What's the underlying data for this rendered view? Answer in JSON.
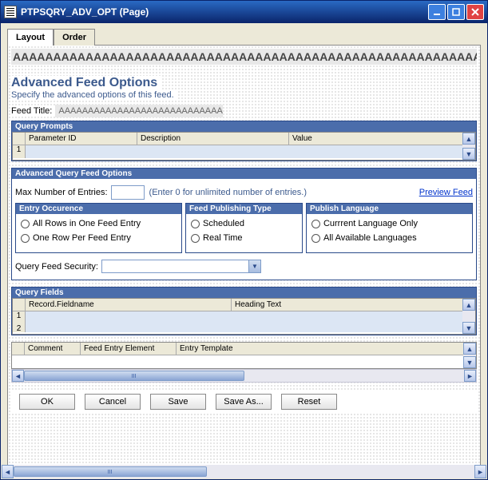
{
  "window": {
    "title": "PTPSQRY_ADV_OPT (Page)"
  },
  "tabs": {
    "layout": "Layout",
    "order": "Order"
  },
  "banner": "AAAAAAAAAAAAAAAAAAAAAAAAAAAAAAAAAAAAAAAAAAAAAAAAAAAAAAAAAAAAAAA",
  "heading": "Advanced Feed Options",
  "subheading": "Specify the advanced options of this feed.",
  "feed_title": {
    "label": "Feed Title:",
    "value": "AAAAAAAAAAAAAAAAAAAAAAAAAAAAAA"
  },
  "query_prompts": {
    "title": "Query Prompts",
    "columns": {
      "param_id": "Parameter ID",
      "description": "Description",
      "value": "Value"
    },
    "rownum1": "1"
  },
  "adv_options": {
    "title": "Advanced Query Feed Options",
    "max_entries_label": "Max Number of Entries:",
    "max_entries_value": "",
    "max_entries_hint": "(Enter 0 for unlimited number of entries.)",
    "preview_link": "Preview Feed",
    "entry_occurrence": {
      "title": "Entry Occurence",
      "opt_allrows": "All Rows in One Feed Entry",
      "opt_onerow": "One Row Per Feed Entry"
    },
    "publishing_type": {
      "title": "Feed Publishing Type",
      "opt_scheduled": "Scheduled",
      "opt_realtime": "Real Time"
    },
    "publish_language": {
      "title": "Publish Language",
      "opt_current": "Currrent Language Only",
      "opt_all": "All Available Languages"
    },
    "feed_security_label": "Query Feed Security:",
    "feed_security_value": ""
  },
  "query_fields": {
    "title": "Query Fields",
    "columns": {
      "recfield": "Record.Fieldname",
      "heading": "Heading Text"
    },
    "rownum1": "1",
    "rownum2": "2"
  },
  "assoc_grid": {
    "columns": {
      "comment": "Comment",
      "feed_entry_elem": "Feed Entry Element",
      "entry_template": "Entry Template"
    }
  },
  "buttons": {
    "ok": "OK",
    "cancel": "Cancel",
    "save": "Save",
    "saveas": "Save As...",
    "reset": "Reset"
  }
}
